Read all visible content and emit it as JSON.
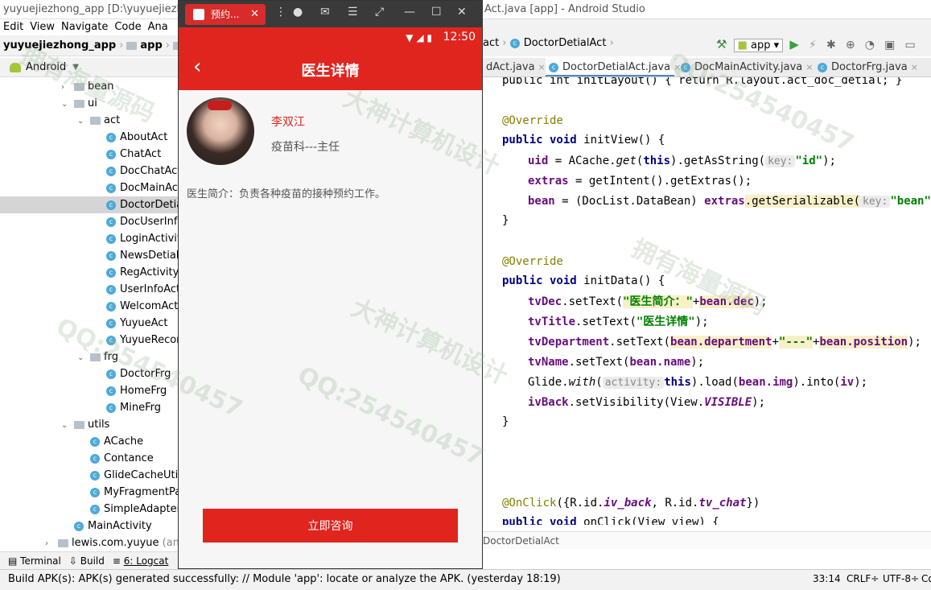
{
  "window": {
    "title_left": "yuyuejiezhong_app [D:\\yuyuejiezhong",
    "title_right": "Act.java [app] - Android Studio"
  },
  "menu": [
    "Edit",
    "View",
    "Navigate",
    "Code",
    "Ana"
  ],
  "nav": {
    "project": "yuyuejiezhong_app",
    "module": "app",
    "more": "s"
  },
  "project_view": {
    "mode": "Android"
  },
  "tree": [
    {
      "label": "bean",
      "type": "folder",
      "indent": 1,
      "expanded": false
    },
    {
      "label": "ui",
      "type": "folder",
      "indent": 1,
      "expanded": true
    },
    {
      "label": "act",
      "type": "folder",
      "indent": 2,
      "expanded": true
    },
    {
      "label": "AboutAct",
      "type": "class",
      "indent": 3
    },
    {
      "label": "ChatAct",
      "type": "class",
      "indent": 3
    },
    {
      "label": "DocChatAct",
      "type": "class",
      "indent": 3
    },
    {
      "label": "DocMainActivi",
      "type": "class",
      "indent": 3
    },
    {
      "label": "DoctorDetialAc",
      "type": "class",
      "indent": 3,
      "selected": true
    },
    {
      "label": "DocUserInfoAc",
      "type": "class",
      "indent": 3
    },
    {
      "label": "LoginActivity",
      "type": "class",
      "indent": 3
    },
    {
      "label": "NewsDetialAc",
      "type": "class",
      "indent": 3
    },
    {
      "label": "RegActivity",
      "type": "class",
      "indent": 3
    },
    {
      "label": "UserInfoAct",
      "type": "class",
      "indent": 3
    },
    {
      "label": "WelcomAct",
      "type": "class",
      "indent": 3
    },
    {
      "label": "YuyueAct",
      "type": "class",
      "indent": 3
    },
    {
      "label": "YuyueRecordA",
      "type": "class",
      "indent": 3
    },
    {
      "label": "frg",
      "type": "folder",
      "indent": 2,
      "expanded": true
    },
    {
      "label": "DoctorFrg",
      "type": "class",
      "indent": 3
    },
    {
      "label": "HomeFrg",
      "type": "class",
      "indent": 3
    },
    {
      "label": "MineFrg",
      "type": "class",
      "indent": 3
    },
    {
      "label": "utils",
      "type": "folder",
      "indent": 1,
      "expanded": true
    },
    {
      "label": "ACache",
      "type": "class",
      "indent": 2
    },
    {
      "label": "Contance",
      "type": "class",
      "indent": 2
    },
    {
      "label": "GlideCacheUtil",
      "type": "class",
      "indent": 2
    },
    {
      "label": "MyFragmentPage",
      "type": "class",
      "indent": 2
    },
    {
      "label": "SimpleAdapter",
      "type": "class",
      "indent": 2
    },
    {
      "label": "MainActivity",
      "type": "class",
      "indent": 1
    },
    {
      "label": "lewis.com.yuyue",
      "type": "folder",
      "indent": 0,
      "suffix": "(androi"
    }
  ],
  "bottom_tools": {
    "terminal": "Terminal",
    "build": "Build",
    "logcat": "6: Logcat"
  },
  "status": {
    "message": "Build APK(s): APK(s) generated successfully: // Module 'app': locate or analyze the APK. (yesterday 18:19)",
    "position": "33:14",
    "line_sep": "CRLF÷",
    "encoding": "UTF-8÷",
    "extra": "Co"
  },
  "emulator": {
    "tab_title": "预约...",
    "time": "12:50",
    "app_title": "医生详情",
    "doctor_name": "李双江",
    "doctor_dept": "疫苗科---主任",
    "doctor_desc": "医生简介：负责各种疫苗的接种预约工作。",
    "consult_button": "立即咨询"
  },
  "editor": {
    "breadcrumb_prev": "act",
    "breadcrumb_cur": "DoctorDetialAct",
    "run_config": "app",
    "tabs": [
      "dAct.java",
      "DoctorDetialAct.java",
      "DocMainActivity.java",
      "DoctorFrg.java"
    ],
    "active_tab": 1,
    "footer_crumb": "DoctorDetialAct"
  },
  "code": {
    "l0": "public int initLayout() { return R.layout.act_doc_detial; }",
    "ann1": "@Override",
    "m1_kw": "public void",
    "m1_name": " initView() {",
    "l_uid_a": "uid",
    "l_uid_b": " = ACache.",
    "l_uid_get": "get",
    "l_uid_c": "(",
    "l_this": "this",
    "l_uid_d": ").getAsString(",
    "hint_key": "key:",
    "str_id": "\"id\"",
    "semi_paren": ");",
    "l_extras_a": "extras",
    "l_extras_b": " = getIntent().getExtras();",
    "l_bean_a": "bean",
    "l_bean_b": " = (DocList.DataBean) ",
    "l_bean_c": "extras",
    "l_bean_d": ".getSerializable(",
    "str_bean": "\"bean\"",
    "close": "}",
    "ann2": "@Override",
    "m2_kw": "public void",
    "m2_name": " initData() {",
    "tvDec": "tvDec",
    "setText_open": ".setText(",
    "str_dec": "\"医生简介：\"",
    "plus": "+",
    "bean_dec": "bean.dec",
    "tvTitle": "tvTitle",
    "str_title": "\"医生详情\"",
    "tvDepartment": "tvDepartment",
    "bean_department": "bean.department",
    "str_sep": "\"---\"",
    "bean_position": "bean.position",
    "tvName": "tvName",
    "bean_name": "bean.name",
    "glide_a": "Glide.",
    "glide_with": "with",
    "hint_activity": "activity:",
    "glide_b": ").load(",
    "bean_img": "bean.img",
    "glide_c": ").into(",
    "iv": "iv",
    "glide_d": ");",
    "ivBack": "ivBack",
    "ivback_b": ".setVisibility(View.",
    "visible": "VISIBLE",
    "onclick_ann": "@OnClick",
    "onclick_b": "({R.id.",
    "iv_back": "iv_back",
    "onclick_c": ", R.id.",
    "tv_chat": "tv_chat",
    "onclick_d": "})",
    "m3_kw": "public void",
    "m3_name": " onClick(View view) {"
  },
  "watermarks": [
    "QQ:254540457",
    "大神计算机设计",
    "拥有海量源码"
  ],
  "colors": {
    "accent_red": "#e0251f",
    "selected_row": "#d5d5d5"
  }
}
